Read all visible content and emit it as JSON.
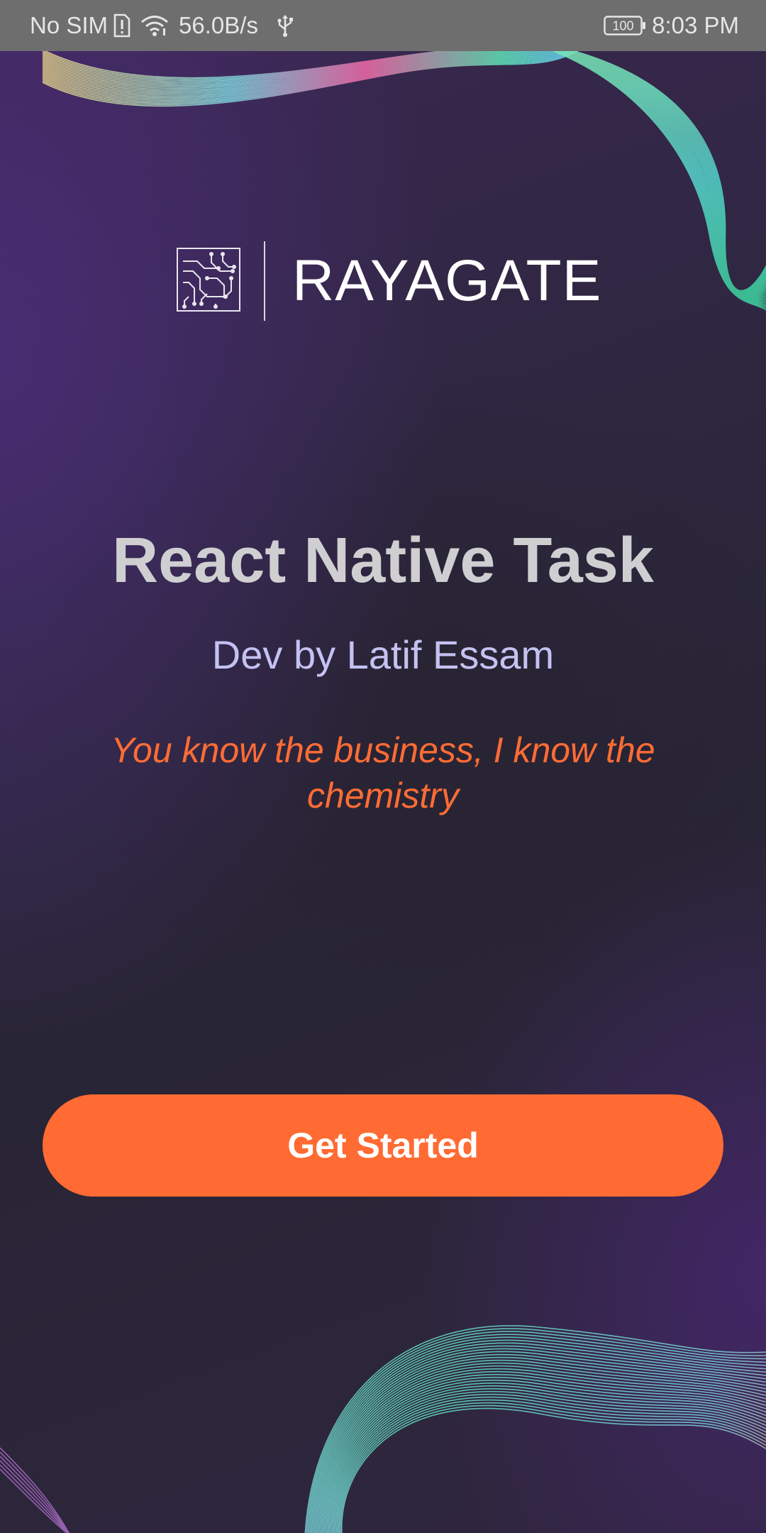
{
  "status_bar": {
    "carrier": "No SIM",
    "net_speed": "56.0B/s",
    "battery_level": "100",
    "time": "8:03 PM",
    "icons": [
      "sim-alert-icon",
      "wifi-icon",
      "usb-icon",
      "battery-icon"
    ]
  },
  "logo": {
    "brand": "RAYAGATE",
    "icon": "circuit-board-icon"
  },
  "main": {
    "title": "React Native Task",
    "subtitle": "Dev by Latif Essam",
    "tagline": "You know the business, I know the chemistry"
  },
  "actions": {
    "get_started_label": "Get Started"
  },
  "colors": {
    "accent": "#ff6b33",
    "subtitle": "#c4c2f2",
    "title": "#cfcfd2",
    "status_bar": "#6e6e6e"
  }
}
